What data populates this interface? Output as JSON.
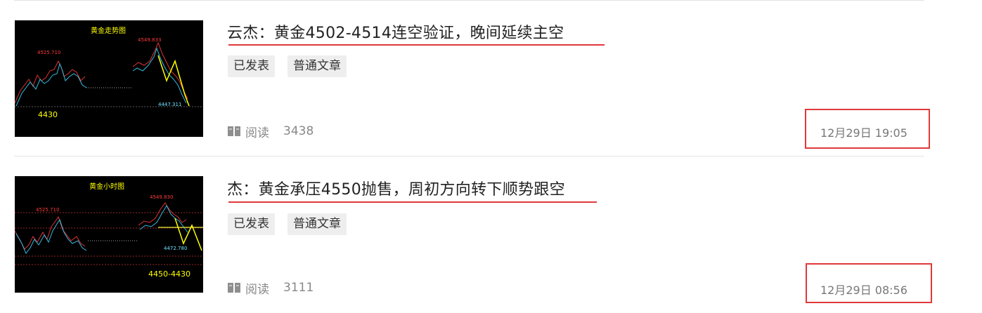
{
  "articles": [
    {
      "title": "云杰：黄金4502-4514连空验证，晚间延续主空",
      "tags": [
        "已发表",
        "普通文章"
      ],
      "read_label": "阅读",
      "read_count": "3438",
      "date": "12月29日 19:05",
      "thumb": {
        "title": "黄金走势图",
        "high_label": "4549.833",
        "left_label": "4525.710",
        "low_label": "4447.311",
        "support_label": "4430"
      }
    },
    {
      "title": "杰：黄金承压4550抛售，周初方向转下顺势跟空",
      "tags": [
        "已发表",
        "普通文章"
      ],
      "read_label": "阅读",
      "read_count": "3111",
      "date": "12月29日 08:56",
      "thumb": {
        "title": "黄金小时图",
        "high_label": "4549.830",
        "left_label": "4525.710",
        "low_label": "4472.780",
        "support_label": "4450-4430"
      }
    }
  ],
  "icons": {
    "read": "book-icon"
  },
  "colors": {
    "accent": "#e0393a",
    "thumb_bg": "#000000",
    "thumb_title": "#ffff00",
    "thumb_price": "#ff3b3b",
    "thumb_low": "#6fe3ff"
  }
}
